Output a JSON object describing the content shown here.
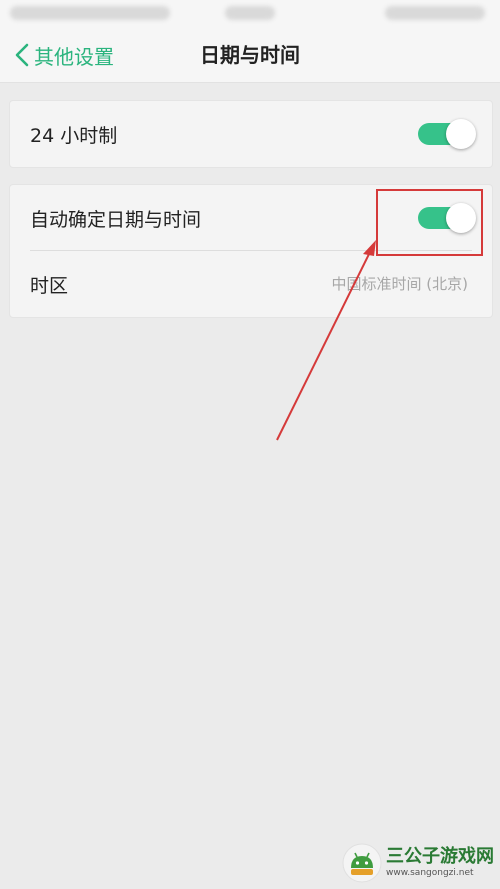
{
  "nav": {
    "back_label": "其他设置",
    "title": "日期与时间"
  },
  "settings": {
    "hour24": {
      "label": "24 小时制",
      "enabled": true
    },
    "auto_datetime": {
      "label": "自动确定日期与时间",
      "enabled": true
    },
    "timezone": {
      "label": "时区",
      "value": "中国标准时间 (北京)"
    }
  },
  "colors": {
    "accent": "#2bb47e",
    "toggle_on": "#36c28a",
    "annotation": "#d53a3a"
  },
  "watermark": {
    "name": "三公子游戏网",
    "url": "www.sangongzi.net"
  }
}
